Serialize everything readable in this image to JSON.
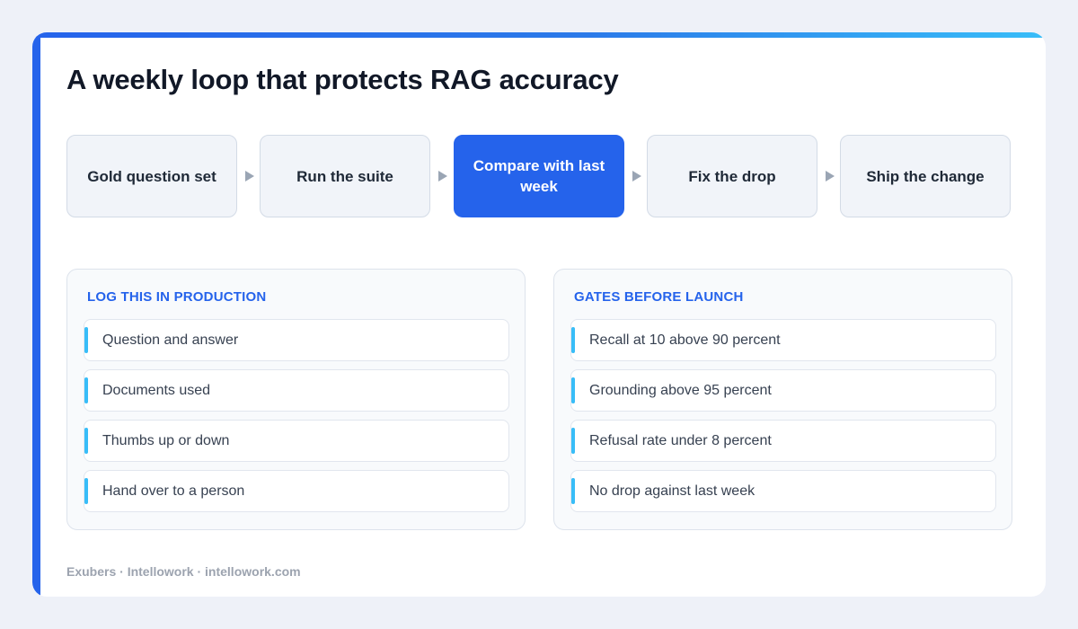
{
  "title": "A weekly loop that protects RAG accuracy",
  "flow": {
    "steps": [
      {
        "label": "Gold question set",
        "active": false
      },
      {
        "label": "Run the suite",
        "active": false
      },
      {
        "label": "Compare with last week",
        "active": true
      },
      {
        "label": "Fix the drop",
        "active": false
      },
      {
        "label": "Ship the change",
        "active": false
      }
    ],
    "arrow_icon": "triangle-right-icon"
  },
  "panels": {
    "log": {
      "heading": "LOG THIS IN PRODUCTION",
      "items": [
        "Question and answer",
        "Documents used",
        "Thumbs up or down",
        "Hand over to a person"
      ]
    },
    "gates": {
      "heading": "GATES BEFORE LAUNCH",
      "items": [
        "Recall at 10 above 90 percent",
        "Grounding above 95 percent",
        "Refusal rate under 8 percent",
        "No drop against last week"
      ]
    }
  },
  "footer": "Exubers · Intellowork · intellowork.com",
  "colors": {
    "accent": "#2563eb",
    "accent_light": "#38bdf8",
    "page_background": "#eef1f8",
    "step_background": "#f1f4f9"
  }
}
